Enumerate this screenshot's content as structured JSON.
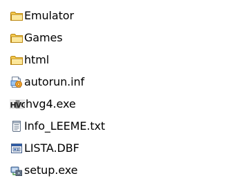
{
  "files": [
    {
      "name": "Emulator",
      "type": "folder",
      "icon": "folder-icon"
    },
    {
      "name": "Games",
      "type": "folder",
      "icon": "folder-icon"
    },
    {
      "name": "html",
      "type": "folder",
      "icon": "folder-icon"
    },
    {
      "name": "autorun.inf",
      "type": "setup-info",
      "icon": "autorun-inf-icon"
    },
    {
      "name": "hvg4.exe",
      "type": "application",
      "icon": "hvg-app-icon"
    },
    {
      "name": "Info_LEEME.txt",
      "type": "text",
      "icon": "text-file-icon"
    },
    {
      "name": "LISTA.DBF",
      "type": "database",
      "icon": "dbf-file-icon"
    },
    {
      "name": "setup.exe",
      "type": "installer",
      "icon": "setup-exe-icon"
    }
  ],
  "colors": {
    "folder_fill": "#f6d36b",
    "folder_edge": "#c8961d",
    "background": "#ffffff"
  }
}
